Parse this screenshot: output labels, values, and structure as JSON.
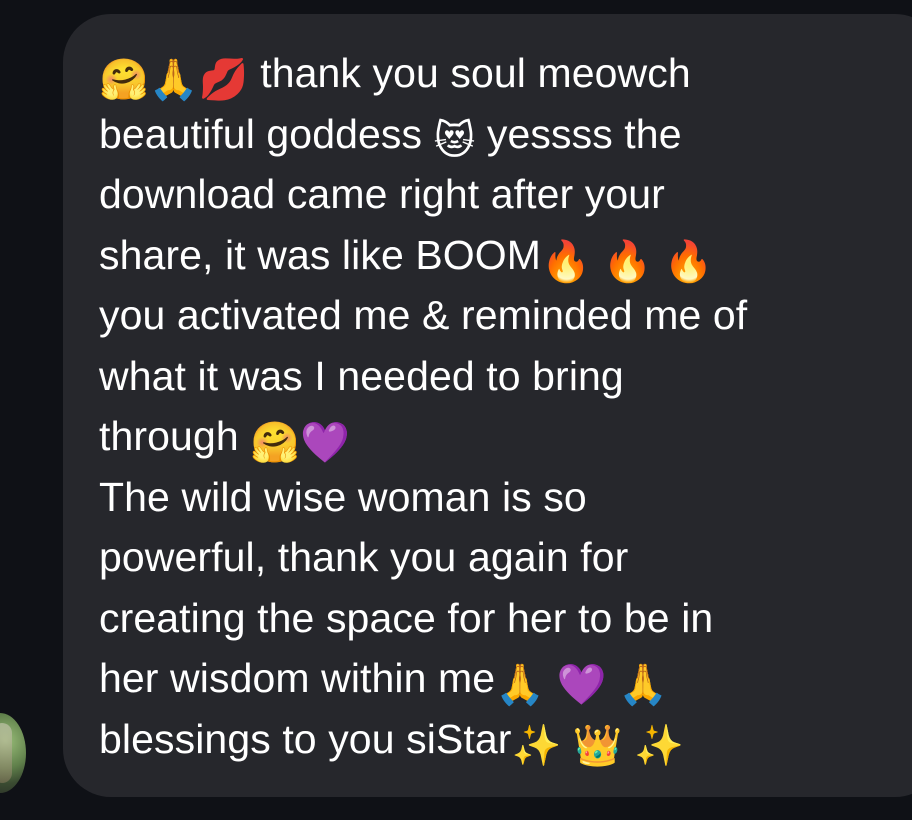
{
  "message": {
    "lines": [
      [
        {
          "t": "emoji",
          "v": "🤗"
        },
        {
          "t": "emoji",
          "v": "🙏"
        },
        {
          "t": "emoji",
          "v": "💋"
        },
        {
          "t": "text",
          "v": " thank you soul meowch"
        }
      ],
      [
        {
          "t": "text",
          "v": "beautiful goddess "
        },
        {
          "t": "emoji",
          "v": "😻"
        },
        {
          "t": "text",
          "v": " yessss the"
        }
      ],
      [
        {
          "t": "text",
          "v": "download came right after your"
        }
      ],
      [
        {
          "t": "text",
          "v": "share, it was like BOOM"
        },
        {
          "t": "emoji",
          "v": "🔥"
        },
        {
          "t": "text",
          "v": " "
        },
        {
          "t": "emoji",
          "v": "🔥"
        },
        {
          "t": "text",
          "v": " "
        },
        {
          "t": "emoji",
          "v": "🔥"
        }
      ],
      [
        {
          "t": "text",
          "v": "you activated me & reminded me of"
        }
      ],
      [
        {
          "t": "text",
          "v": "what it was I needed to bring"
        }
      ],
      [
        {
          "t": "text",
          "v": "through "
        },
        {
          "t": "emoji",
          "v": "🤗"
        },
        {
          "t": "emoji",
          "v": "💜"
        }
      ],
      [
        {
          "t": "text",
          "v": "The wild wise woman is so"
        }
      ],
      [
        {
          "t": "text",
          "v": "powerful, thank you again for"
        }
      ],
      [
        {
          "t": "text",
          "v": "creating the space for her to be in"
        }
      ],
      [
        {
          "t": "text",
          "v": "her wisdom within me"
        },
        {
          "t": "emoji",
          "v": "🙏"
        },
        {
          "t": "text",
          "v": " "
        },
        {
          "t": "emoji",
          "v": "💜"
        },
        {
          "t": "text",
          "v": " "
        },
        {
          "t": "emoji",
          "v": "🙏"
        }
      ],
      [
        {
          "t": "text",
          "v": "blessings to you siStar"
        },
        {
          "t": "emoji",
          "v": "✨"
        },
        {
          "t": "text",
          "v": " "
        },
        {
          "t": "emoji",
          "v": "👑"
        },
        {
          "t": "text",
          "v": " "
        },
        {
          "t": "emoji",
          "v": "✨"
        }
      ]
    ]
  },
  "colors": {
    "background": "#0f1116",
    "bubble": "#26272c",
    "text": "#ffffff"
  }
}
